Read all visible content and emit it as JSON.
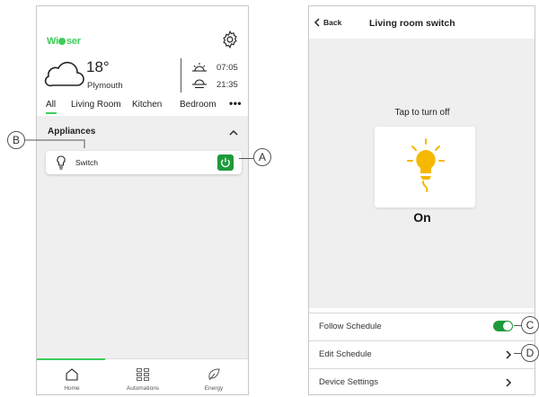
{
  "home": {
    "logo": {
      "brand_initial": "Wi",
      "brand_rest": "ser"
    },
    "weather": {
      "temperature": "18°",
      "city": "Plymouth",
      "sunrise": "07:05",
      "sunset": "21:35"
    },
    "tabs": [
      {
        "label": "All",
        "active": true
      },
      {
        "label": "Living Room",
        "active": false
      },
      {
        "label": "Kitchen",
        "active": false
      },
      {
        "label": "Bedroom",
        "active": false
      }
    ],
    "more": "•••",
    "section_title": "Appliances",
    "device": {
      "name": "Switch",
      "icon": "bulb-icon",
      "state": "on"
    },
    "nav": [
      {
        "label": "Home",
        "icon": "home-icon",
        "active": true
      },
      {
        "label": "Automations",
        "icon": "automations-grid-icon",
        "active": false
      },
      {
        "label": "Energy",
        "icon": "energy-leaf-icon",
        "active": false
      }
    ]
  },
  "callouts": {
    "a": "A",
    "b": "B",
    "c": "C",
    "d": "D"
  },
  "detail": {
    "back_label": "Back",
    "title": "Living room switch",
    "instruction": "Tap to turn off",
    "state": "On",
    "settings": [
      {
        "label": "Follow Schedule",
        "control": "toggle",
        "value": true
      },
      {
        "label": "Edit Schedule",
        "control": "chevron"
      },
      {
        "label": "Device Settings",
        "control": "chevron"
      }
    ]
  },
  "colors": {
    "accent_green": "#3dcd58",
    "dark_green": "#1e9a3b",
    "bulb_yellow": "#f5b800",
    "background_gray": "#efefef"
  }
}
